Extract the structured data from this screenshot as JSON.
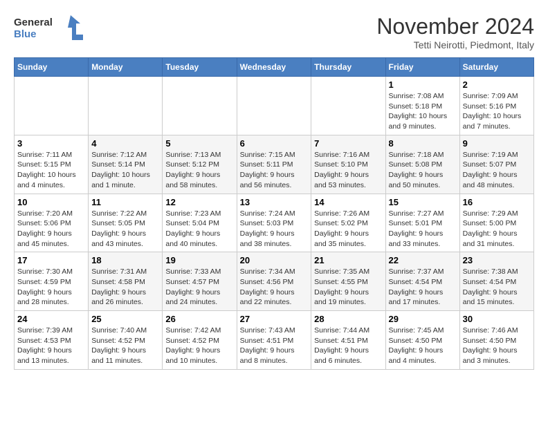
{
  "header": {
    "logo_line1": "General",
    "logo_line2": "Blue",
    "month_title": "November 2024",
    "location": "Tetti Neirotti, Piedmont, Italy"
  },
  "weekdays": [
    "Sunday",
    "Monday",
    "Tuesday",
    "Wednesday",
    "Thursday",
    "Friday",
    "Saturday"
  ],
  "weeks": [
    [
      {
        "day": "",
        "info": ""
      },
      {
        "day": "",
        "info": ""
      },
      {
        "day": "",
        "info": ""
      },
      {
        "day": "",
        "info": ""
      },
      {
        "day": "",
        "info": ""
      },
      {
        "day": "1",
        "info": "Sunrise: 7:08 AM\nSunset: 5:18 PM\nDaylight: 10 hours and 9 minutes."
      },
      {
        "day": "2",
        "info": "Sunrise: 7:09 AM\nSunset: 5:16 PM\nDaylight: 10 hours and 7 minutes."
      }
    ],
    [
      {
        "day": "3",
        "info": "Sunrise: 7:11 AM\nSunset: 5:15 PM\nDaylight: 10 hours and 4 minutes."
      },
      {
        "day": "4",
        "info": "Sunrise: 7:12 AM\nSunset: 5:14 PM\nDaylight: 10 hours and 1 minute."
      },
      {
        "day": "5",
        "info": "Sunrise: 7:13 AM\nSunset: 5:12 PM\nDaylight: 9 hours and 58 minutes."
      },
      {
        "day": "6",
        "info": "Sunrise: 7:15 AM\nSunset: 5:11 PM\nDaylight: 9 hours and 56 minutes."
      },
      {
        "day": "7",
        "info": "Sunrise: 7:16 AM\nSunset: 5:10 PM\nDaylight: 9 hours and 53 minutes."
      },
      {
        "day": "8",
        "info": "Sunrise: 7:18 AM\nSunset: 5:08 PM\nDaylight: 9 hours and 50 minutes."
      },
      {
        "day": "9",
        "info": "Sunrise: 7:19 AM\nSunset: 5:07 PM\nDaylight: 9 hours and 48 minutes."
      }
    ],
    [
      {
        "day": "10",
        "info": "Sunrise: 7:20 AM\nSunset: 5:06 PM\nDaylight: 9 hours and 45 minutes."
      },
      {
        "day": "11",
        "info": "Sunrise: 7:22 AM\nSunset: 5:05 PM\nDaylight: 9 hours and 43 minutes."
      },
      {
        "day": "12",
        "info": "Sunrise: 7:23 AM\nSunset: 5:04 PM\nDaylight: 9 hours and 40 minutes."
      },
      {
        "day": "13",
        "info": "Sunrise: 7:24 AM\nSunset: 5:03 PM\nDaylight: 9 hours and 38 minutes."
      },
      {
        "day": "14",
        "info": "Sunrise: 7:26 AM\nSunset: 5:02 PM\nDaylight: 9 hours and 35 minutes."
      },
      {
        "day": "15",
        "info": "Sunrise: 7:27 AM\nSunset: 5:01 PM\nDaylight: 9 hours and 33 minutes."
      },
      {
        "day": "16",
        "info": "Sunrise: 7:29 AM\nSunset: 5:00 PM\nDaylight: 9 hours and 31 minutes."
      }
    ],
    [
      {
        "day": "17",
        "info": "Sunrise: 7:30 AM\nSunset: 4:59 PM\nDaylight: 9 hours and 28 minutes."
      },
      {
        "day": "18",
        "info": "Sunrise: 7:31 AM\nSunset: 4:58 PM\nDaylight: 9 hours and 26 minutes."
      },
      {
        "day": "19",
        "info": "Sunrise: 7:33 AM\nSunset: 4:57 PM\nDaylight: 9 hours and 24 minutes."
      },
      {
        "day": "20",
        "info": "Sunrise: 7:34 AM\nSunset: 4:56 PM\nDaylight: 9 hours and 22 minutes."
      },
      {
        "day": "21",
        "info": "Sunrise: 7:35 AM\nSunset: 4:55 PM\nDaylight: 9 hours and 19 minutes."
      },
      {
        "day": "22",
        "info": "Sunrise: 7:37 AM\nSunset: 4:54 PM\nDaylight: 9 hours and 17 minutes."
      },
      {
        "day": "23",
        "info": "Sunrise: 7:38 AM\nSunset: 4:54 PM\nDaylight: 9 hours and 15 minutes."
      }
    ],
    [
      {
        "day": "24",
        "info": "Sunrise: 7:39 AM\nSunset: 4:53 PM\nDaylight: 9 hours and 13 minutes."
      },
      {
        "day": "25",
        "info": "Sunrise: 7:40 AM\nSunset: 4:52 PM\nDaylight: 9 hours and 11 minutes."
      },
      {
        "day": "26",
        "info": "Sunrise: 7:42 AM\nSunset: 4:52 PM\nDaylight: 9 hours and 10 minutes."
      },
      {
        "day": "27",
        "info": "Sunrise: 7:43 AM\nSunset: 4:51 PM\nDaylight: 9 hours and 8 minutes."
      },
      {
        "day": "28",
        "info": "Sunrise: 7:44 AM\nSunset: 4:51 PM\nDaylight: 9 hours and 6 minutes."
      },
      {
        "day": "29",
        "info": "Sunrise: 7:45 AM\nSunset: 4:50 PM\nDaylight: 9 hours and 4 minutes."
      },
      {
        "day": "30",
        "info": "Sunrise: 7:46 AM\nSunset: 4:50 PM\nDaylight: 9 hours and 3 minutes."
      }
    ]
  ]
}
